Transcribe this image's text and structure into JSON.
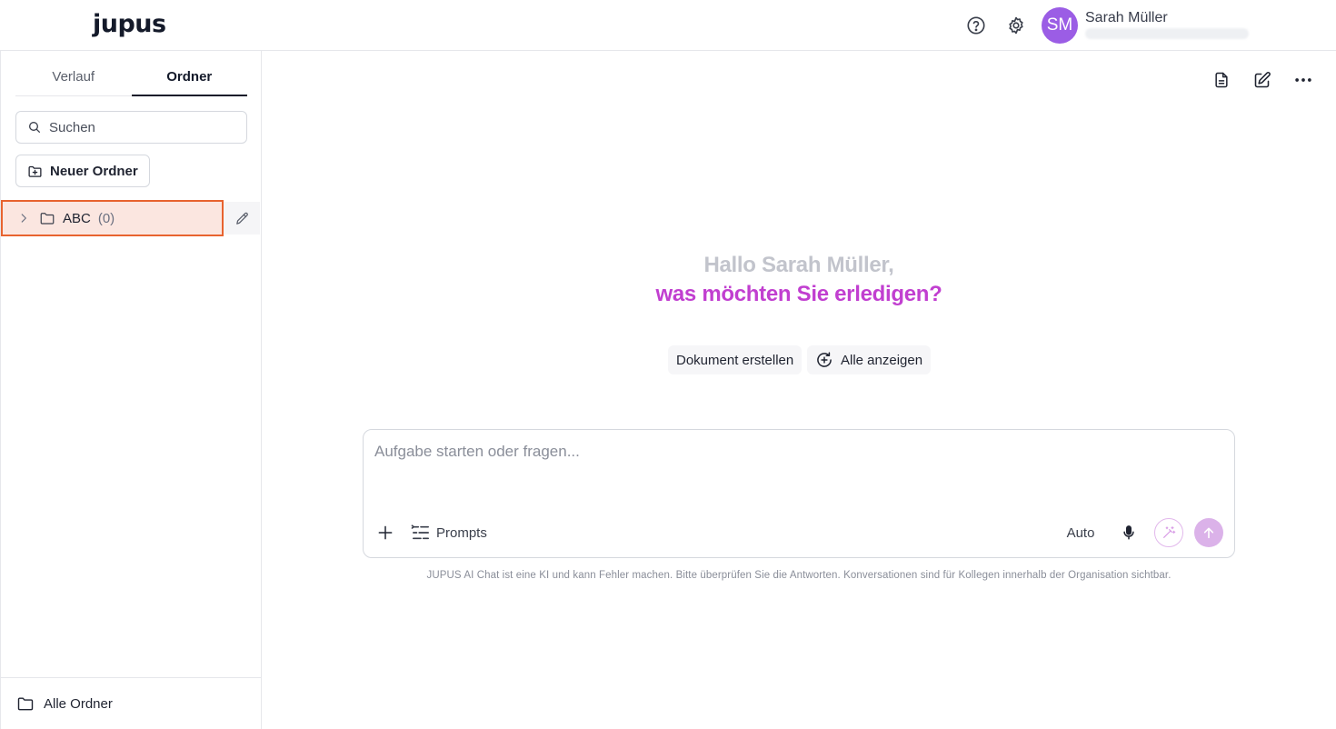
{
  "header": {
    "logo": "jupus",
    "help_icon": "help-circle-icon",
    "settings_icon": "gear-icon",
    "user": {
      "initials": "SM",
      "name": "Sarah Müller",
      "avatar_color": "#9b5de5"
    }
  },
  "sidebar": {
    "tabs": [
      {
        "label": "Verlauf",
        "active": false
      },
      {
        "label": "Ordner",
        "active": true
      }
    ],
    "search": {
      "placeholder": "Suchen"
    },
    "new_folder_label": "Neuer Ordner",
    "folders": [
      {
        "name": "ABC",
        "count": "(0)",
        "selected": true
      }
    ],
    "all_folders_label": "Alle Ordner"
  },
  "main": {
    "top_actions": [
      "document-icon",
      "new-chat-edit-icon",
      "more-horizontal-icon"
    ],
    "greeting_line1": "Hallo Sarah Müller,",
    "greeting_line2": "was möchten Sie erledigen?",
    "accent_color": "#c13fd0",
    "suggestions": [
      {
        "label": "Dokument erstellen"
      },
      {
        "label": "Alle anzeigen",
        "icon": "plus-circle-arrows-icon"
      }
    ],
    "composer": {
      "placeholder": "Aufgabe starten oder fragen...",
      "prompts_label": "Prompts",
      "model_label": "Auto"
    },
    "disclaimer": "JUPUS AI Chat ist eine KI und kann Fehler machen. Bitte überprüfen Sie die Antworten. Konversationen sind für Kollegen innerhalb der Organisation sichtbar."
  }
}
